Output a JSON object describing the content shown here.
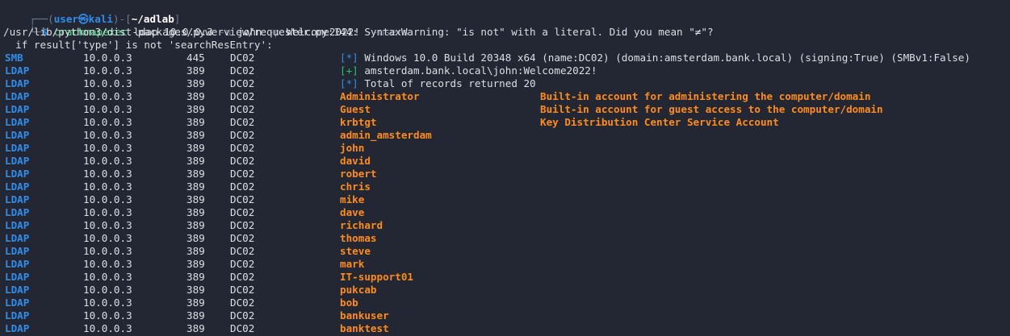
{
  "prompt": {
    "corner_top": "┌──(",
    "user_host": "user㉿kali",
    "bridge": ")-[",
    "path": "~/adlab",
    "close": "]",
    "corner_bottom": "└─",
    "dollar": "$ ",
    "command_name": "crackmapexec",
    "command_args": " ldap 10.0.0.3 ",
    "flag_u": "-u",
    "user_arg": " john ",
    "flag_p": "-p",
    "pass_arg": " Welcome2022! ",
    "flag_users": "--users"
  },
  "warning": {
    "line1": "/usr/lib/python3/dist-packages/pywerview/requester.py:144: SyntaxWarning: \"is not\" with a literal. Did you mean \"≠\"?",
    "line2": "  if result['type'] is not 'searchResEntry':"
  },
  "rows": [
    {
      "proto": "SMB",
      "ip": "10.0.0.3",
      "port": "445",
      "host": "DC02",
      "marker": "[*]",
      "marker_color": "blue",
      "text": "Windows 10.0 Build 20348 x64 (name:DC02) (domain:amsterdam.bank.local) (signing:True) (SMBv1:False)",
      "desc": ""
    },
    {
      "proto": "LDAP",
      "ip": "10.0.0.3",
      "port": "389",
      "host": "DC02",
      "marker": "[+]",
      "marker_color": "green",
      "text": "amsterdam.bank.local\\john:Welcome2022!",
      "desc": ""
    },
    {
      "proto": "LDAP",
      "ip": "10.0.0.3",
      "port": "389",
      "host": "DC02",
      "marker": "[*]",
      "marker_color": "blue",
      "text": "Total of records returned 20",
      "desc": ""
    },
    {
      "proto": "LDAP",
      "ip": "10.0.0.3",
      "port": "389",
      "host": "DC02",
      "user": "Administrator",
      "desc": "Built-in account for administering the computer/domain"
    },
    {
      "proto": "LDAP",
      "ip": "10.0.0.3",
      "port": "389",
      "host": "DC02",
      "user": "Guest",
      "desc": "Built-in account for guest access to the computer/domain"
    },
    {
      "proto": "LDAP",
      "ip": "10.0.0.3",
      "port": "389",
      "host": "DC02",
      "user": "krbtgt",
      "desc": "Key Distribution Center Service Account"
    },
    {
      "proto": "LDAP",
      "ip": "10.0.0.3",
      "port": "389",
      "host": "DC02",
      "user": "admin_amsterdam",
      "desc": ""
    },
    {
      "proto": "LDAP",
      "ip": "10.0.0.3",
      "port": "389",
      "host": "DC02",
      "user": "john",
      "desc": ""
    },
    {
      "proto": "LDAP",
      "ip": "10.0.0.3",
      "port": "389",
      "host": "DC02",
      "user": "david",
      "desc": ""
    },
    {
      "proto": "LDAP",
      "ip": "10.0.0.3",
      "port": "389",
      "host": "DC02",
      "user": "robert",
      "desc": ""
    },
    {
      "proto": "LDAP",
      "ip": "10.0.0.3",
      "port": "389",
      "host": "DC02",
      "user": "chris",
      "desc": ""
    },
    {
      "proto": "LDAP",
      "ip": "10.0.0.3",
      "port": "389",
      "host": "DC02",
      "user": "mike",
      "desc": ""
    },
    {
      "proto": "LDAP",
      "ip": "10.0.0.3",
      "port": "389",
      "host": "DC02",
      "user": "dave",
      "desc": ""
    },
    {
      "proto": "LDAP",
      "ip": "10.0.0.3",
      "port": "389",
      "host": "DC02",
      "user": "richard",
      "desc": ""
    },
    {
      "proto": "LDAP",
      "ip": "10.0.0.3",
      "port": "389",
      "host": "DC02",
      "user": "thomas",
      "desc": ""
    },
    {
      "proto": "LDAP",
      "ip": "10.0.0.3",
      "port": "389",
      "host": "DC02",
      "user": "steve",
      "desc": ""
    },
    {
      "proto": "LDAP",
      "ip": "10.0.0.3",
      "port": "389",
      "host": "DC02",
      "user": "mark",
      "desc": ""
    },
    {
      "proto": "LDAP",
      "ip": "10.0.0.3",
      "port": "389",
      "host": "DC02",
      "user": "IT-support01",
      "desc": ""
    },
    {
      "proto": "LDAP",
      "ip": "10.0.0.3",
      "port": "389",
      "host": "DC02",
      "user": "pukcab",
      "desc": ""
    },
    {
      "proto": "LDAP",
      "ip": "10.0.0.3",
      "port": "389",
      "host": "DC02",
      "user": "bob",
      "desc": ""
    },
    {
      "proto": "LDAP",
      "ip": "10.0.0.3",
      "port": "389",
      "host": "DC02",
      "user": "bankuser",
      "desc": ""
    },
    {
      "proto": "LDAP",
      "ip": "10.0.0.3",
      "port": "389",
      "host": "DC02",
      "user": "banktest",
      "desc": ""
    }
  ],
  "colors": {
    "background": "#232733",
    "text": "#dcdfe4",
    "protocol_blue": "#2f8ee8",
    "success_green": "#22c55e",
    "username_orange": "#ff8c1a"
  }
}
